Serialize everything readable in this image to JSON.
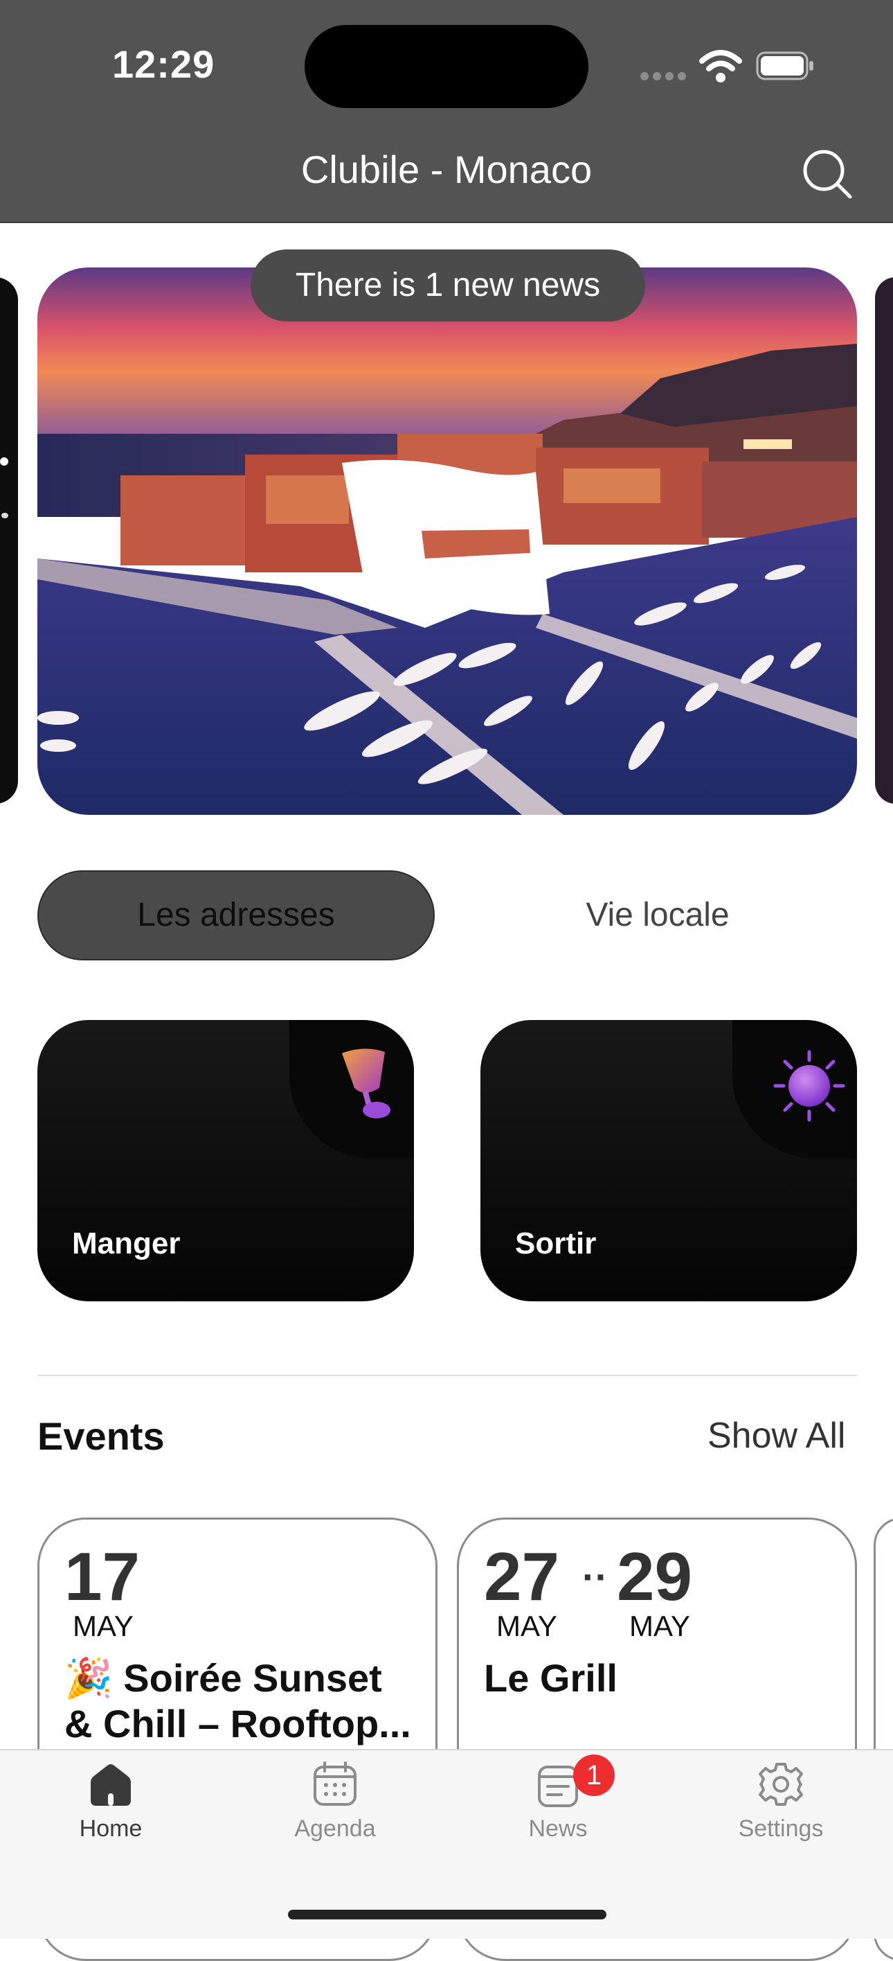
{
  "status_bar": {
    "time": "12:29"
  },
  "header": {
    "title": "Clubile - Monaco",
    "search_icon": "search-icon"
  },
  "hero": {
    "toast": "There is 1 new news",
    "image": "monaco-harbor-sunset",
    "logo_icon": "flag-logo-icon"
  },
  "segmented": {
    "active": "Les adresses",
    "inactive": "Vie locale"
  },
  "categories": [
    {
      "label": "Manger",
      "icon": "wine-glass-icon"
    },
    {
      "label": "Sortir",
      "icon": "sun-icon"
    }
  ],
  "events_section": {
    "title": "Events",
    "show_all": "Show All"
  },
  "events": [
    {
      "day": "17",
      "month": "MAY",
      "emoji": "🎉",
      "title_line1": "Soirée Sunset",
      "title_line2": "& Chill – Rooftop..."
    },
    {
      "day_start": "27",
      "month_start": "MAY",
      "separator": "··",
      "day_end": "29",
      "month_end": "MAY",
      "title": "Le Grill"
    }
  ],
  "tabbar": {
    "items": [
      {
        "label": "Home",
        "icon": "home-icon",
        "active": true
      },
      {
        "label": "Agenda",
        "icon": "calendar-icon",
        "active": false
      },
      {
        "label": "News",
        "icon": "news-icon",
        "active": false,
        "badge": "1"
      },
      {
        "label": "Settings",
        "icon": "gear-icon",
        "active": false
      }
    ]
  },
  "colors": {
    "header_bg": "#535353",
    "badge": "#ee2d2f",
    "segment_active": "#4a4a4a"
  }
}
